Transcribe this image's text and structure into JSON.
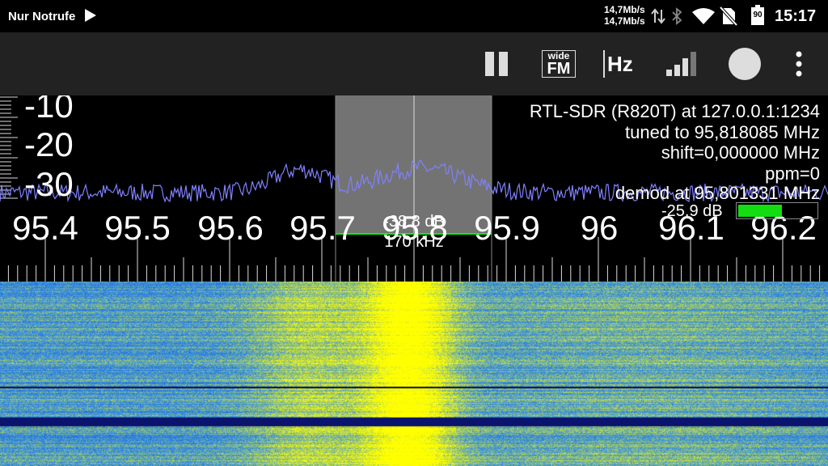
{
  "status_bar": {
    "carrier": "Nur Notrufe",
    "net_up": "14,7Mb/s",
    "net_down": "14,7Mb/s",
    "battery": "90",
    "time": "15:17",
    "icons": [
      "play-icon",
      "data-arrows-icon",
      "bluetooth-icon",
      "wifi-icon",
      "no-sim-icon",
      "battery-icon"
    ]
  },
  "toolbar": {
    "mode_top": "wide",
    "mode_bottom": "FM",
    "unit_label": "Hz",
    "icons": [
      "pause-icon",
      "mode-icon",
      "unit-icon",
      "signal-bars-icon",
      "record-icon",
      "more-vert-icon"
    ]
  },
  "spectrum": {
    "db_labels": [
      "-10",
      "-20",
      "-30"
    ],
    "freq_labels": [
      "95.4",
      "95.5",
      "95.6",
      "95.7",
      "95.8",
      "95.9",
      "96",
      "96.1",
      "96.2"
    ],
    "selection_level": "-38.8 dB",
    "selection_bandwidth": "170 kHz",
    "squelch_level": "-25.9 dB",
    "colors": {
      "trace": "#8080ff",
      "selection": "#808080",
      "squelch": "#00ff00",
      "waterfall_low": "#2a4fd0",
      "waterfall_high": "#ffff00"
    }
  },
  "info": {
    "device": "RTL-SDR (R820T) at 127.0.0.1:1234",
    "tuned": "tuned to 95,818085 MHz",
    "shift": "shift=0,000000 MHz",
    "ppm": "ppm=0",
    "demod": "demod at 95,801331 MHz"
  }
}
